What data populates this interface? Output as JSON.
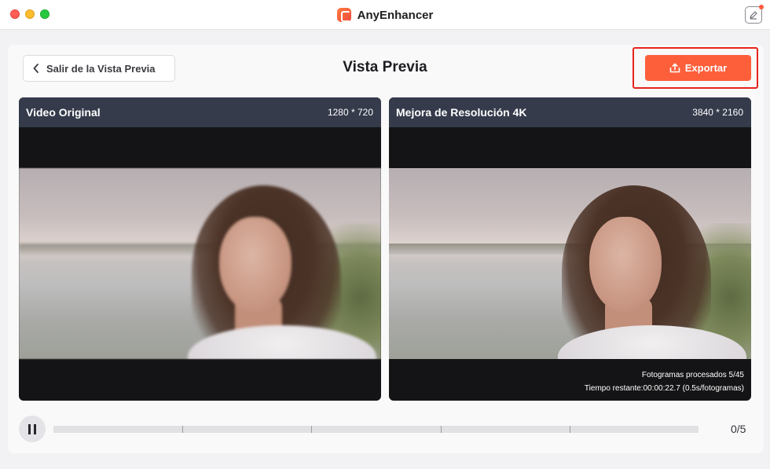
{
  "window": {
    "app_name": "AnyEnhancer"
  },
  "toolbar": {
    "back_label": "Salir de la Vista Previa",
    "page_title": "Vista Previa",
    "export_label": "Exportar"
  },
  "panels": {
    "original": {
      "label": "Video Original",
      "resolution": "1280 * 720"
    },
    "enhanced": {
      "label": "Mejora de Resolución 4K",
      "resolution": "3840 * 2160",
      "frames_processed": "Fotogramas procesados 5/45",
      "time_remaining": "Tiempo restante:00:00:22.7 (0.5s/fotogramas)"
    }
  },
  "playback": {
    "counter": "0/5",
    "progress_fraction": 0,
    "segments": 5
  },
  "colors": {
    "accent": "#fe5f3b",
    "panel_header": "#353b4b",
    "highlight": "#e8231d"
  },
  "icons": {
    "back": "chevron-left-icon",
    "export": "export-icon",
    "pause": "pause-icon",
    "feedback": "edit-feedback-icon"
  }
}
